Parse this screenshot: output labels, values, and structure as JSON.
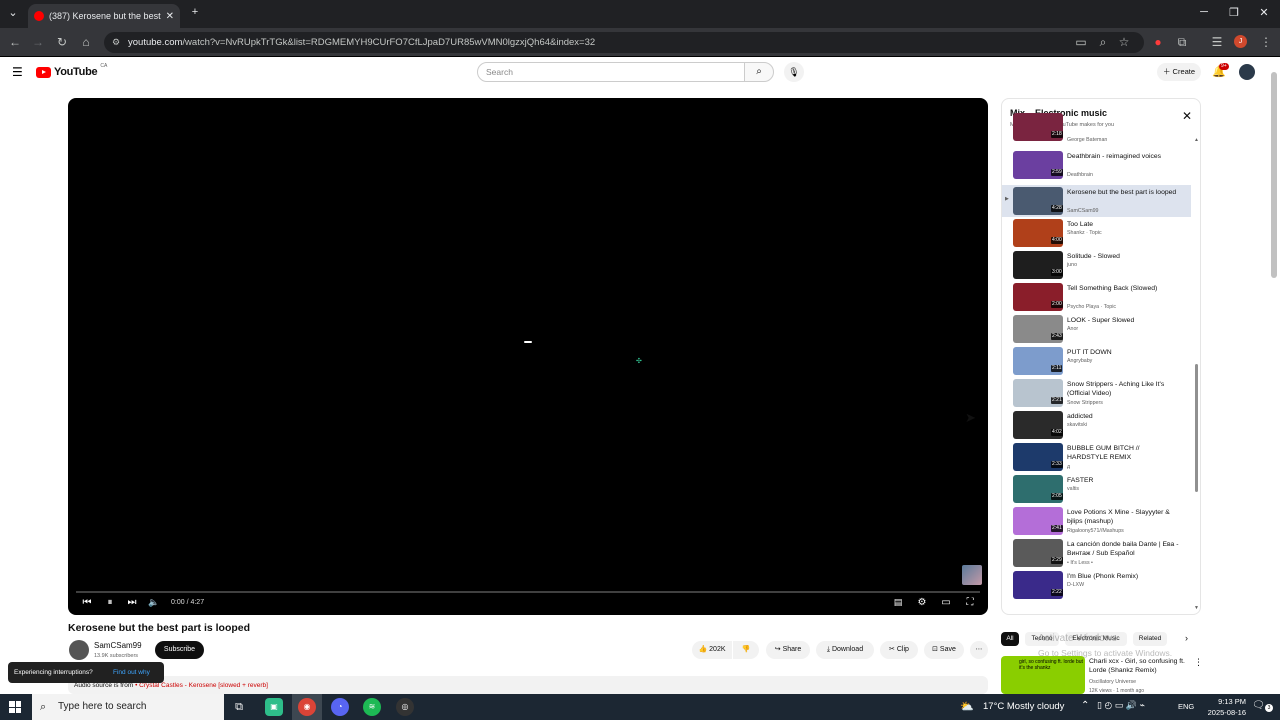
{
  "browser": {
    "tab_title": "(387) Kerosene but the best part is looped - YouTube",
    "url_host": "youtube.com",
    "url_path": "/watch?v=NvRUpkTrTGk&list=RDGMEMYH9CUrFO7CfLJpaD7UR85wVMN0lgzxjQh64&index=32",
    "new_tab": "+",
    "close_tab": "✕"
  },
  "youtube": {
    "logo_word": "YouTube",
    "logo_region": "CA",
    "search_placeholder": "Search",
    "create_label": "Create",
    "notif_count": "9+"
  },
  "player": {
    "time": "0:00 / 4:27"
  },
  "video": {
    "title": "Kerosene but the best part is looped",
    "channel": "SamCSam99",
    "subscribers": "13.9K subscribers",
    "subscribe_label": "Subscribe",
    "likes": "202K",
    "share_label": "Share",
    "download_label": "Download",
    "clip_label": "Clip",
    "save_label": "Save",
    "description_prefix": "Audio source is from",
    "description_link": "• Crystal Castles - Kerosene [slowed + reverb]"
  },
  "toast": {
    "text": "Experiencing interruptions?",
    "link": "Find out why"
  },
  "playlist": {
    "title": "Mix – Electronic music",
    "subtitle": "Mixes are playlists YouTube makes for you",
    "partial_top": {
      "duration": "2:18",
      "channel": "George Bateman",
      "color": "#7a2440"
    },
    "items": [
      {
        "title": "Deathbrain - reimagined voices",
        "channel": "Deathbrain",
        "duration": "2:59",
        "color": "#6b3fa0"
      },
      {
        "title": "Kerosene but the best part is looped",
        "channel": "SamCSam99",
        "duration": "4:28",
        "color": "#4a5a70",
        "active": true
      },
      {
        "title": "Too Late",
        "channel": "Shankz · Topic",
        "duration": "4:00",
        "color": "#b0401a"
      },
      {
        "title": "Solitude - Slowed",
        "channel": "juno",
        "duration": "3:00",
        "color": "#1e1e1e"
      },
      {
        "title": "Tell Something Back (Slowed)",
        "channel": "Psycho Playa · Topic",
        "duration": "2:00",
        "color": "#8a1e2a"
      },
      {
        "title": "LOOK - Super Slowed",
        "channel": "Anor",
        "duration": "2:43",
        "color": "#8a8a8a"
      },
      {
        "title": "PUT IT DOWN",
        "channel": "Angrybaby",
        "duration": "2:11",
        "color": "#7d9ccc"
      },
      {
        "title": "Snow Strippers - Aching Like It's (Official Video)",
        "channel": "Snow Strippers",
        "duration": "2:21",
        "color": "#b8c4cf"
      },
      {
        "title": "addicted",
        "channel": "skavitski",
        "duration": "4:02",
        "color": "#2a2a2a"
      },
      {
        "title": "BUBBLE GUM BITCH // HARDSTYLE REMIX",
        "channel": "д",
        "duration": "2:33",
        "color": "#1d3a6b"
      },
      {
        "title": "FASTER",
        "channel": "valtis",
        "duration": "2:05",
        "color": "#2e6e6e"
      },
      {
        "title": "Love Potions X Mine - Slayyyter & bjlips (mashup)",
        "channel": "Rigaloony571//Mashups",
        "duration": "2:41",
        "color": "#b46ed8"
      },
      {
        "title": "La canción donde baila Dante | Ева - Винтаж / Sub Español",
        "channel": "• It's Less •",
        "duration": "2:29",
        "color": "#5a5a5a"
      },
      {
        "title": "I'm Blue (Phonk Remix)",
        "channel": "D-LXW",
        "duration": "2:22",
        "color": "#3a2a8a"
      }
    ]
  },
  "chips": [
    "All",
    "Techno",
    "Electronic Music",
    "Related"
  ],
  "related": {
    "title": "Charli xcx - Girl, so confusing ft. Lorde (Shankz Remix)",
    "channel": "Oscillatory Universe",
    "meta": "12K views · 1 month ago",
    "thumb_text": "girl, so confusing ft. lorde but it's the shankz"
  },
  "watermark": {
    "line1": "Activate Windows",
    "line2": "Go to Settings to activate Windows."
  },
  "taskbar": {
    "search_placeholder": "Type here to search",
    "weather": "17°C  Mostly cloudy",
    "lang": "ENG",
    "time": "9:13 PM",
    "date": "2025-08-16",
    "notif_count": "3"
  }
}
